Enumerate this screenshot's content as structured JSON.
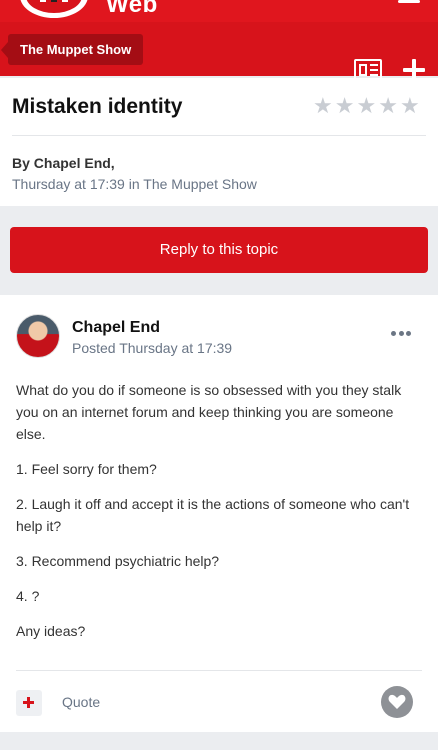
{
  "header": {
    "site_name": "Web"
  },
  "breadcrumb": {
    "label": "The Muppet Show"
  },
  "topic": {
    "title": "Mistaken identity",
    "rating": 0,
    "rating_max": 5,
    "byline": "By Chapel End,",
    "dateline": "Thursday at 17:39 in The Muppet Show"
  },
  "reply_button": "Reply to this topic",
  "post": {
    "author": "Chapel End",
    "posted": "Posted Thursday at 17:39",
    "paragraphs": [
      "What do you do if someone is so obsessed with you they stalk you on an internet forum and keep thinking you are someone else.",
      "1. Feel sorry for them?",
      "2. Laugh it off and accept it is the actions of someone who can't help it?",
      "3. Recommend psychiatric help?",
      "4. ?",
      "Any ideas?"
    ],
    "quote_label": "Quote"
  },
  "colors": {
    "brand_red": "#d7131b",
    "dark_red": "#a40d14",
    "muted_text": "#697586"
  }
}
